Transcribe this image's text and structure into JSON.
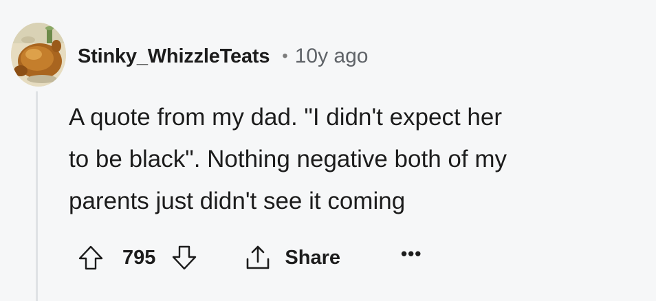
{
  "comment": {
    "avatar_icon": "roast-turkey-avatar",
    "username": "Stinky_WhizzleTeats",
    "separator": "•",
    "time_ago": "10y ago",
    "lines": [
      "A quote from my dad. \"I didn't expect her",
      "to be black\". Nothing negative both of my",
      "parents just didn't see it coming"
    ],
    "actions": {
      "upvote_icon": "arrow-up-icon",
      "vote_count": "795",
      "downvote_icon": "arrow-down-icon",
      "share_icon": "share-icon",
      "share_label": "Share",
      "more_label": "•••"
    }
  },
  "colors": {
    "background": "#f6f7f8",
    "text": "#1c1c1c",
    "muted": "#5f6368",
    "thread_line": "#dfe2e5"
  }
}
